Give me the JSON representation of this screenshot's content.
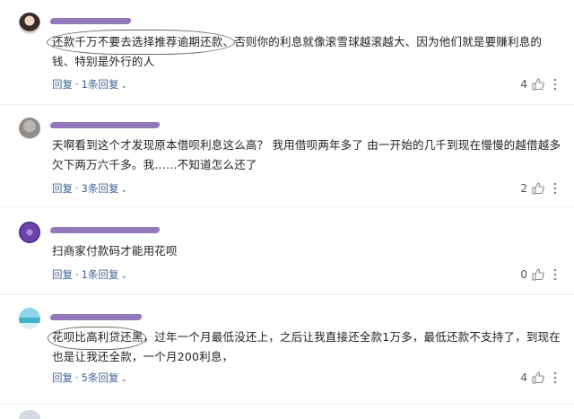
{
  "comments": [
    {
      "username": "",
      "timestamp": "",
      "text": "还款千万不要去选择推荐逾期还款、否则你的利息就像滚雪球越滚越大、因为他们就是要赚利息的钱、特别是外行的人",
      "reply_label": "回复",
      "replies_label": "1条回复",
      "likes": "4"
    },
    {
      "username": "",
      "timestamp": "",
      "text": "天啊看到这个才发现原本借呗利息这么高？ 我用借呗两年多了 由一开始的几千到现在慢慢的越借越多 欠下两万六千多。我……不知道怎么还了",
      "reply_label": "回复",
      "replies_label": "3条回复",
      "likes": "2"
    },
    {
      "username": "",
      "timestamp": "",
      "text": "扫商家付款码才能用花呗",
      "reply_label": "回复",
      "replies_label": "1条回复",
      "likes": "0"
    },
    {
      "username": "",
      "timestamp": "",
      "text": "花呗比高利贷还黑，过年一个月最低没还上，之后让我直接还全款1万多，最低还款不支持了，到现在也是让我还全款，一个月200利息，",
      "reply_label": "回复",
      "replies_label": "5条回复",
      "likes": "4"
    }
  ],
  "icons": {
    "like": "thumbs-up-icon",
    "more": "more-dots-icon",
    "chevron": "chevron-down-icon"
  },
  "colors": {
    "link": "#406599",
    "text": "#222222",
    "redaction": "#6e4aa3"
  }
}
